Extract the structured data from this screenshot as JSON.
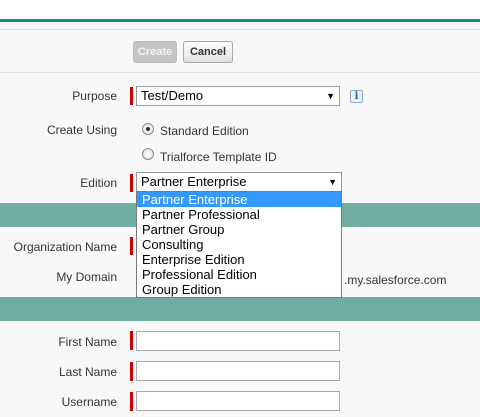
{
  "toolbar": {
    "create_label": "Create",
    "cancel_label": "Cancel"
  },
  "form": {
    "purpose": {
      "label": "Purpose",
      "value": "Test/Demo"
    },
    "create_using": {
      "label": "Create Using",
      "options": [
        "Standard Edition",
        "Trialforce Template ID"
      ],
      "selected": "Standard Edition"
    },
    "edition": {
      "label": "Edition",
      "value": "Partner Enterprise",
      "options": [
        "Partner Enterprise",
        "Partner Professional",
        "Partner Group",
        "Consulting",
        "Enterprise Edition",
        "Professional Edition",
        "Group Edition"
      ]
    },
    "organization_name": {
      "label": "Organization Name",
      "value": ""
    },
    "my_domain": {
      "label": "My Domain",
      "value": "",
      "suffix": ".my.salesforce.com"
    },
    "first_name": {
      "label": "First Name",
      "value": ""
    },
    "last_name": {
      "label": "Last Name",
      "value": ""
    },
    "username": {
      "label": "Username",
      "value": ""
    }
  },
  "icons": {
    "info": "info-icon",
    "dropdown_arrow": "chevron-down-icon"
  },
  "colors": {
    "accent": "#1b8a78",
    "section_band": "#6fada3",
    "required": "#cc0000",
    "highlight": "#3399ff"
  }
}
